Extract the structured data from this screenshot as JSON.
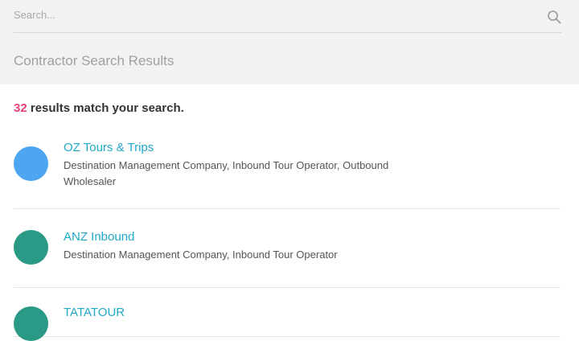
{
  "search": {
    "placeholder": "Search...",
    "icon": "search-icon"
  },
  "header": {
    "title": "Contractor Search Results"
  },
  "summary": {
    "count": "32",
    "text": " results match your search."
  },
  "results": [
    {
      "name": "OZ Tours & Trips",
      "description": "Destination Management Company, Inbound Tour Operator, Outbound Wholesaler",
      "avatar_color": "#4da6ef"
    },
    {
      "name": "ANZ Inbound",
      "description": "Destination Management Company, Inbound Tour Operator",
      "avatar_color": "#2a9a86"
    },
    {
      "name": "TATATOUR",
      "description": "",
      "avatar_color": "#2a9a86"
    }
  ],
  "colors": {
    "accent_link": "#20a9c7",
    "count_highlight": "#e4427a",
    "header_bg": "#f2f2f2"
  }
}
